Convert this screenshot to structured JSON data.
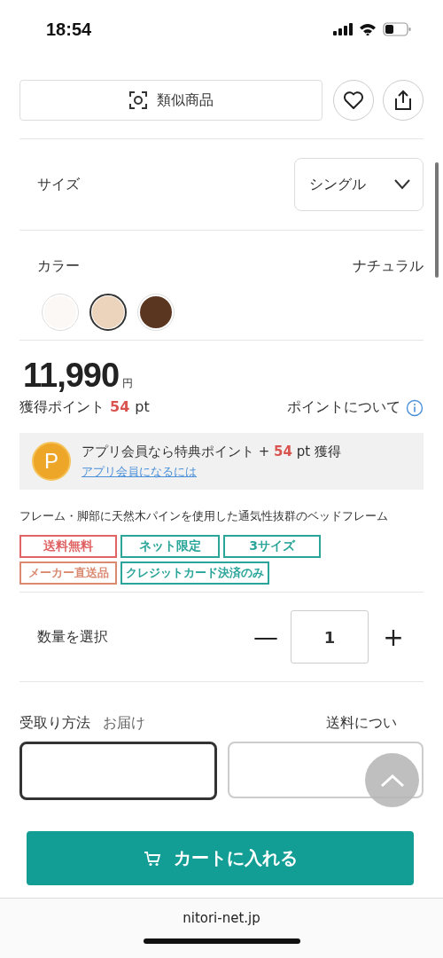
{
  "status_bar": {
    "time": "18:54"
  },
  "actions": {
    "similar_label": "類似商品"
  },
  "size": {
    "label": "サイズ",
    "value": "シングル"
  },
  "color": {
    "label": "カラー",
    "value": "ナチュラル",
    "swatches": [
      {
        "color": "#fbf8f6",
        "selected": false
      },
      {
        "color": "#ecd3bc",
        "selected": true
      },
      {
        "color": "#5a3520",
        "selected": false
      }
    ]
  },
  "price": {
    "amount": "11,990",
    "unit": "円"
  },
  "points": {
    "label": "獲得ポイント",
    "value": "54",
    "unit": "pt",
    "about": "ポイントについて"
  },
  "app_promo": {
    "badge": "P",
    "text": "アプリ会員なら特典ポイント + **54** pt 獲得",
    "link": "アプリ会員になるには"
  },
  "description": "フレーム・脚部に天然木パインを使用した通気性抜群のベッドフレーム",
  "tags": [
    {
      "label": "送料無料",
      "color": "#e06464"
    },
    {
      "label": "ネット限定",
      "color": "#2aa59a"
    },
    {
      "label": "3サイズ",
      "color": "#2aa59a"
    },
    {
      "label": "メーカー直送品",
      "color": "#d98a70"
    },
    {
      "label": "クレジットカード決済のみ",
      "color": "#2aa59a"
    }
  ],
  "quantity": {
    "label": "数量を選択",
    "minus": "—",
    "value": "1",
    "plus": "+"
  },
  "delivery": {
    "label": "受取り方法",
    "value": "お届け",
    "shipping_link": "送料につい",
    "options": [
      {
        "selected": true
      },
      {
        "selected": false
      }
    ]
  },
  "cart_button": {
    "label": "カートに入れる"
  },
  "browser": {
    "url": "nitori-net.jp"
  }
}
